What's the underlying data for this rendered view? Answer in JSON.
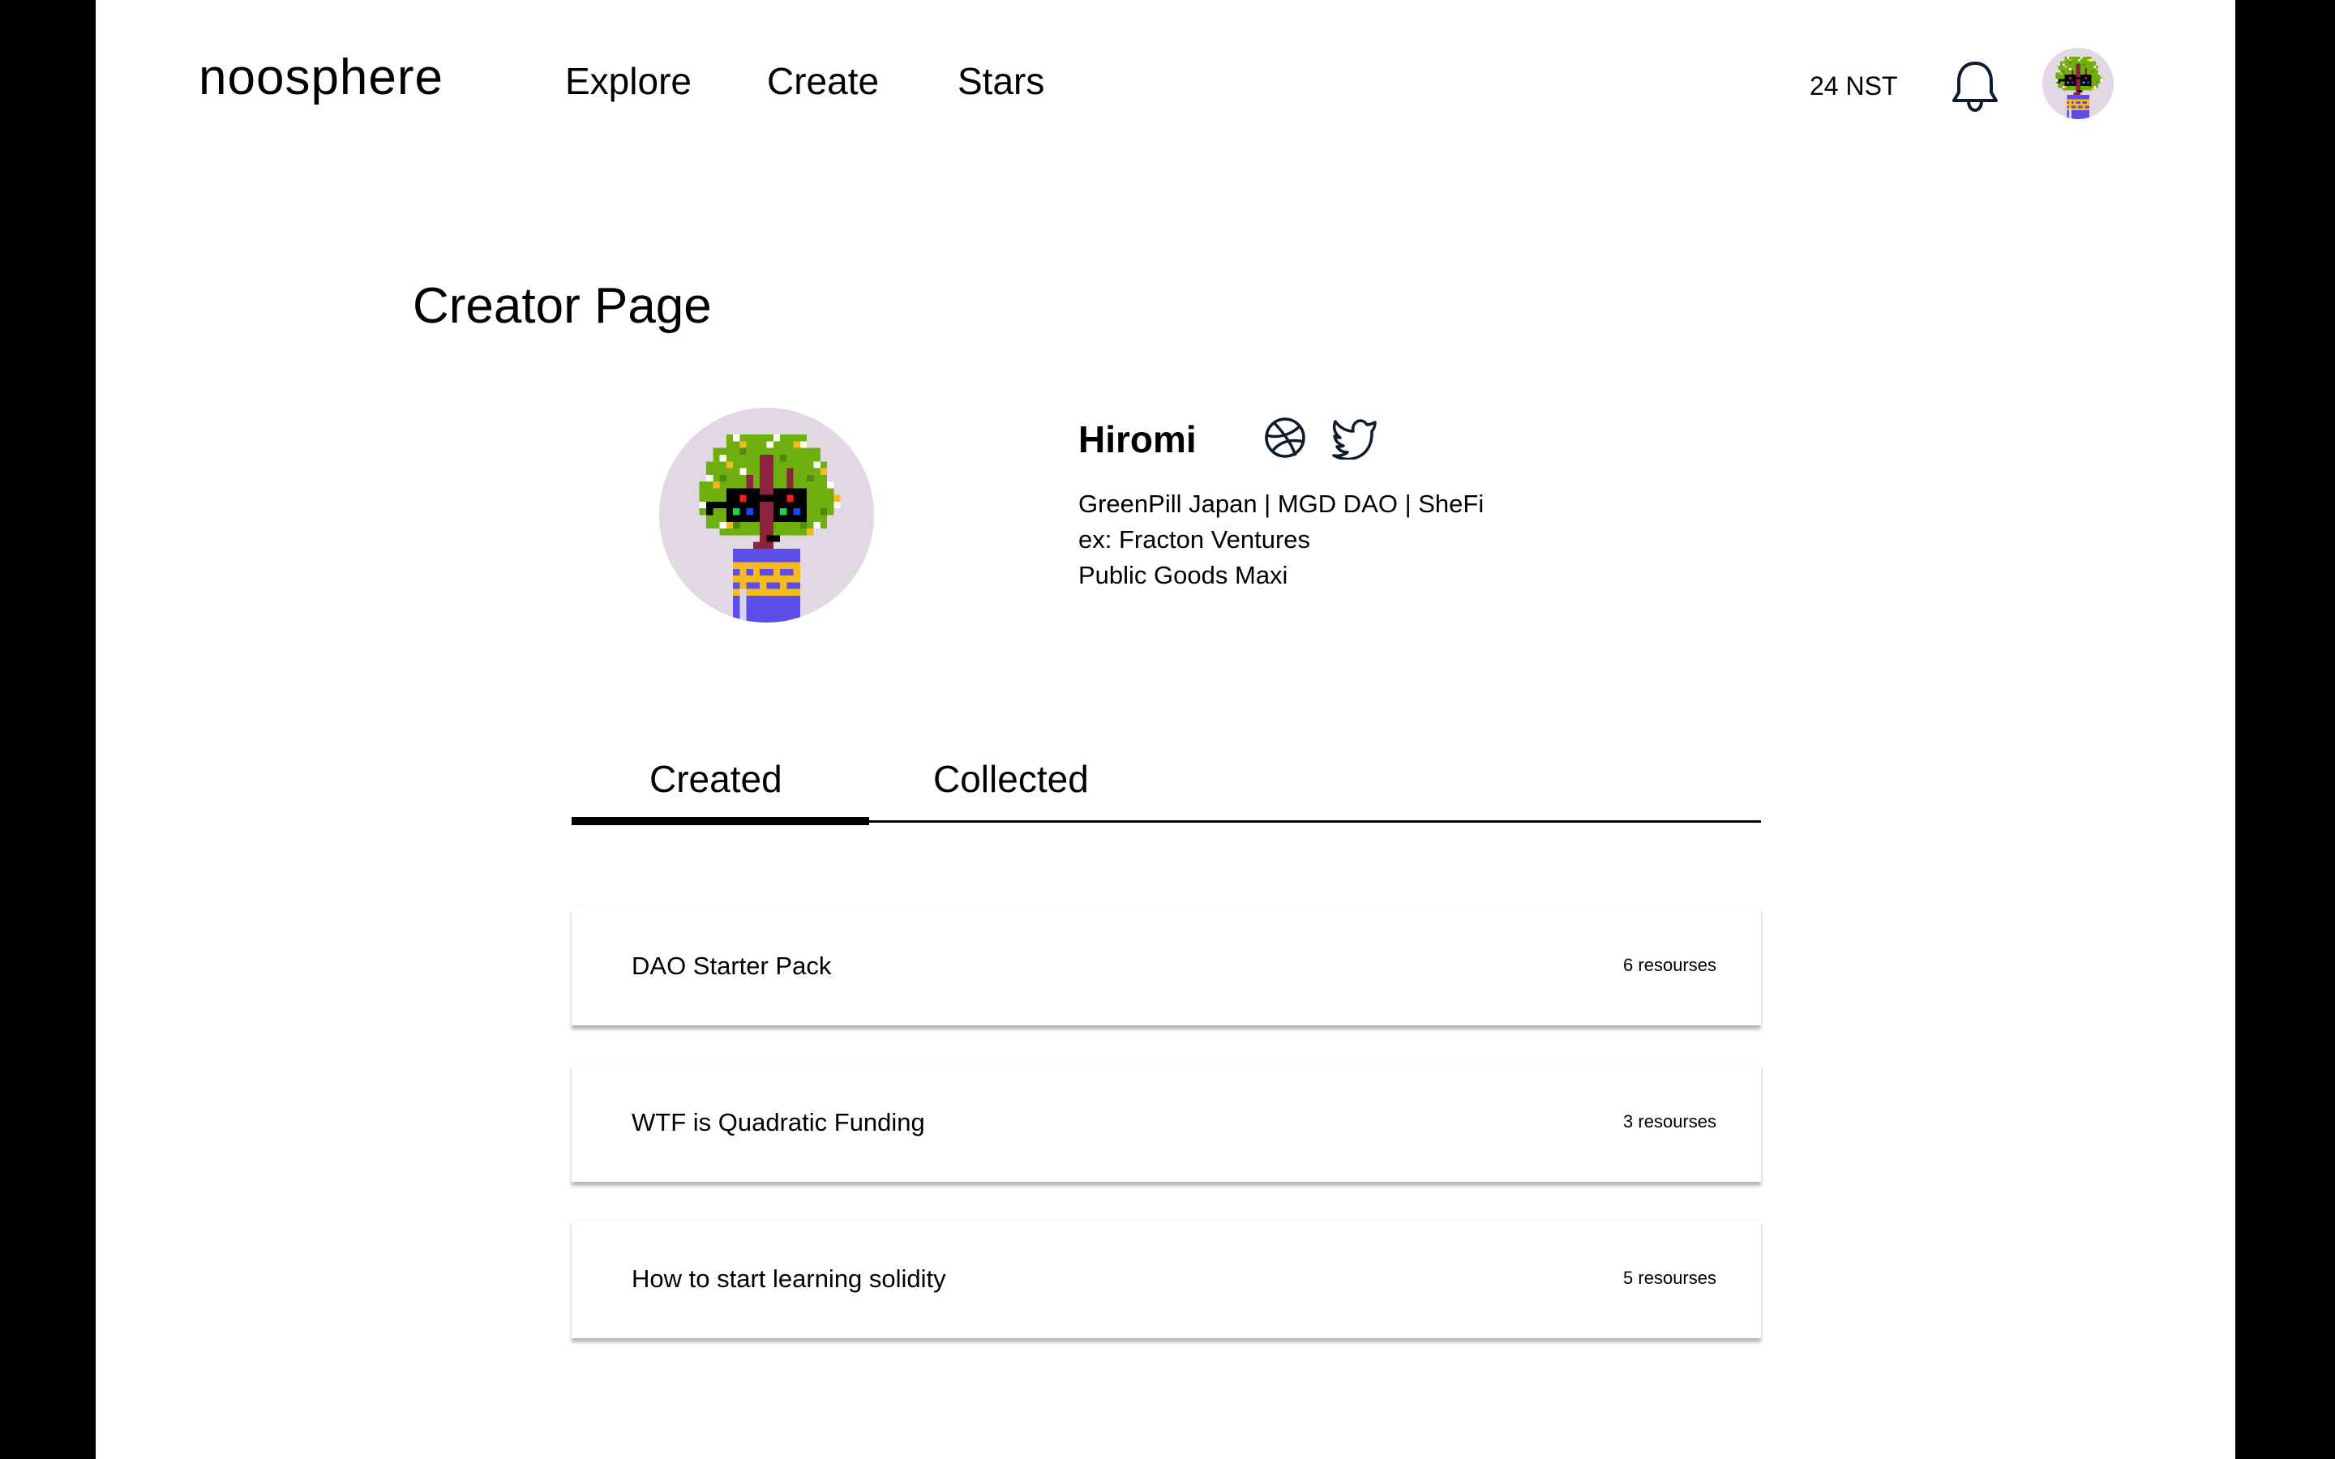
{
  "header": {
    "logo": "noosphere",
    "nav": [
      {
        "label": "Explore"
      },
      {
        "label": "Create"
      },
      {
        "label": "Stars"
      }
    ],
    "balance": "24 NST",
    "icons": {
      "notifications": "bell-icon",
      "account": "avatar"
    }
  },
  "page": {
    "title": "Creator Page"
  },
  "profile": {
    "name": "Hiromi",
    "social_icons": [
      "dribbble-icon",
      "twitter-icon"
    ],
    "bio": [
      "GreenPill Japan | MGD DAO | SheFi",
      "ex: Fracton Ventures",
      "Public Goods Maxi"
    ],
    "avatar_colors": {
      "background": "#E2D8E4",
      "pot": "#5B4EE8",
      "pattern": "#F6B91E",
      "leaves": "#6FAF0F",
      "trunk": "#8E2340",
      "glasses": "#000000"
    }
  },
  "tabs": {
    "items": [
      {
        "label": "Created",
        "active": true
      },
      {
        "label": "Collected",
        "active": false
      }
    ]
  },
  "collections": [
    {
      "title": "DAO Starter Pack",
      "count": "6 resourses"
    },
    {
      "title": "WTF is Quadratic Funding",
      "count": "3 resourses"
    },
    {
      "title": "How to start learning solidity",
      "count": "5 resourses"
    }
  ]
}
